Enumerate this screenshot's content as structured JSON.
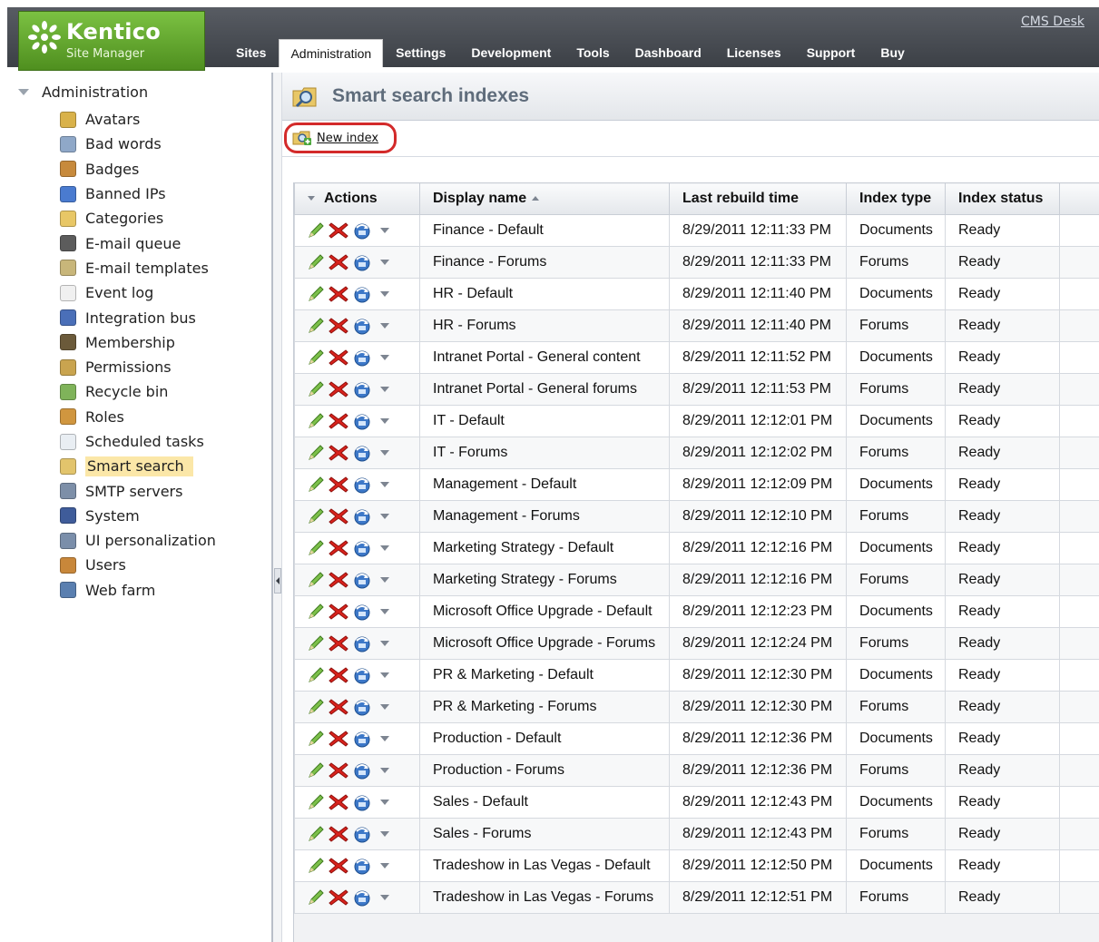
{
  "header": {
    "brand": "Kentico",
    "subtitle": "Site Manager",
    "cms_desk": "CMS Desk",
    "tabs": [
      {
        "label": "Sites",
        "active": false
      },
      {
        "label": "Administration",
        "active": true
      },
      {
        "label": "Settings",
        "active": false
      },
      {
        "label": "Development",
        "active": false
      },
      {
        "label": "Tools",
        "active": false
      },
      {
        "label": "Dashboard",
        "active": false
      },
      {
        "label": "Licenses",
        "active": false
      },
      {
        "label": "Support",
        "active": false
      },
      {
        "label": "Buy",
        "active": false
      }
    ]
  },
  "sidebar": {
    "root": "Administration",
    "items": [
      {
        "label": "Avatars",
        "icon": "avatar-icon",
        "color": "#d9b24a"
      },
      {
        "label": "Bad words",
        "icon": "bad-words-icon",
        "color": "#8fa8c8"
      },
      {
        "label": "Badges",
        "icon": "badges-icon",
        "color": "#c78a3c"
      },
      {
        "label": "Banned IPs",
        "icon": "banned-ips-icon",
        "color": "#4a7bd0"
      },
      {
        "label": "Categories",
        "icon": "categories-icon",
        "color": "#e8c766"
      },
      {
        "label": "E-mail queue",
        "icon": "email-queue-icon",
        "color": "#5c5c5c"
      },
      {
        "label": "E-mail templates",
        "icon": "email-templates-icon",
        "color": "#c8b67a"
      },
      {
        "label": "Event log",
        "icon": "event-log-icon",
        "color": "#f0f0f0"
      },
      {
        "label": "Integration bus",
        "icon": "integration-bus-icon",
        "color": "#4a6fb8"
      },
      {
        "label": "Membership",
        "icon": "membership-icon",
        "color": "#6b5a3a"
      },
      {
        "label": "Permissions",
        "icon": "permissions-icon",
        "color": "#c9a44f"
      },
      {
        "label": "Recycle bin",
        "icon": "recycle-bin-icon",
        "color": "#7fb35a"
      },
      {
        "label": "Roles",
        "icon": "roles-icon",
        "color": "#d0963f"
      },
      {
        "label": "Scheduled tasks",
        "icon": "scheduled-tasks-icon",
        "color": "#e9eef3"
      },
      {
        "label": "Smart search",
        "icon": "smart-search-icon",
        "color": "#e2c46c",
        "selected": true
      },
      {
        "label": "SMTP servers",
        "icon": "smtp-servers-icon",
        "color": "#7d8fa8"
      },
      {
        "label": "System",
        "icon": "system-icon",
        "color": "#3f5c9a"
      },
      {
        "label": "UI personalization",
        "icon": "ui-personalization-icon",
        "color": "#7a8eaa"
      },
      {
        "label": "Users",
        "icon": "users-icon",
        "color": "#c8873a"
      },
      {
        "label": "Web farm",
        "icon": "web-farm-icon",
        "color": "#5a7fb0"
      }
    ]
  },
  "main": {
    "title": "Smart search indexes",
    "new_index": "New index",
    "columns": {
      "actions": "Actions",
      "display_name": "Display name",
      "last_rebuild": "Last rebuild time",
      "index_type": "Index type",
      "index_status": "Index status"
    },
    "rows": [
      {
        "name": "Finance - Default",
        "time": "8/29/2011 12:11:33 PM",
        "type": "Documents",
        "status": "Ready"
      },
      {
        "name": "Finance - Forums",
        "time": "8/29/2011 12:11:33 PM",
        "type": "Forums",
        "status": "Ready"
      },
      {
        "name": "HR - Default",
        "time": "8/29/2011 12:11:40 PM",
        "type": "Documents",
        "status": "Ready"
      },
      {
        "name": "HR - Forums",
        "time": "8/29/2011 12:11:40 PM",
        "type": "Forums",
        "status": "Ready"
      },
      {
        "name": "Intranet Portal - General content",
        "time": "8/29/2011 12:11:52 PM",
        "type": "Documents",
        "status": "Ready"
      },
      {
        "name": "Intranet Portal - General forums",
        "time": "8/29/2011 12:11:53 PM",
        "type": "Forums",
        "status": "Ready"
      },
      {
        "name": "IT - Default",
        "time": "8/29/2011 12:12:01 PM",
        "type": "Documents",
        "status": "Ready"
      },
      {
        "name": "IT - Forums",
        "time": "8/29/2011 12:12:02 PM",
        "type": "Forums",
        "status": "Ready"
      },
      {
        "name": "Management - Default",
        "time": "8/29/2011 12:12:09 PM",
        "type": "Documents",
        "status": "Ready"
      },
      {
        "name": "Management - Forums",
        "time": "8/29/2011 12:12:10 PM",
        "type": "Forums",
        "status": "Ready"
      },
      {
        "name": "Marketing Strategy - Default",
        "time": "8/29/2011 12:12:16 PM",
        "type": "Documents",
        "status": "Ready"
      },
      {
        "name": "Marketing Strategy - Forums",
        "time": "8/29/2011 12:12:16 PM",
        "type": "Forums",
        "status": "Ready"
      },
      {
        "name": "Microsoft Office Upgrade - Default",
        "time": "8/29/2011 12:12:23 PM",
        "type": "Documents",
        "status": "Ready"
      },
      {
        "name": "Microsoft Office Upgrade - Forums",
        "time": "8/29/2011 12:12:24 PM",
        "type": "Forums",
        "status": "Ready"
      },
      {
        "name": "PR & Marketing - Default",
        "time": "8/29/2011 12:12:30 PM",
        "type": "Documents",
        "status": "Ready"
      },
      {
        "name": "PR & Marketing - Forums",
        "time": "8/29/2011 12:12:30 PM",
        "type": "Forums",
        "status": "Ready"
      },
      {
        "name": "Production - Default",
        "time": "8/29/2011 12:12:36 PM",
        "type": "Documents",
        "status": "Ready"
      },
      {
        "name": "Production - Forums",
        "time": "8/29/2011 12:12:36 PM",
        "type": "Forums",
        "status": "Ready"
      },
      {
        "name": "Sales - Default",
        "time": "8/29/2011 12:12:43 PM",
        "type": "Documents",
        "status": "Ready"
      },
      {
        "name": "Sales - Forums",
        "time": "8/29/2011 12:12:43 PM",
        "type": "Forums",
        "status": "Ready"
      },
      {
        "name": "Tradeshow in Las Vegas - Default",
        "time": "8/29/2011 12:12:50 PM",
        "type": "Documents",
        "status": "Ready"
      },
      {
        "name": "Tradeshow in Las Vegas - Forums",
        "time": "8/29/2011 12:12:51 PM",
        "type": "Forums",
        "status": "Ready"
      }
    ]
  },
  "colors": {
    "header_bg": "#4b4f56",
    "logo_green": "#6aae36",
    "selected_highlight": "#fbe7a8",
    "callout_red": "#d32a2a"
  }
}
